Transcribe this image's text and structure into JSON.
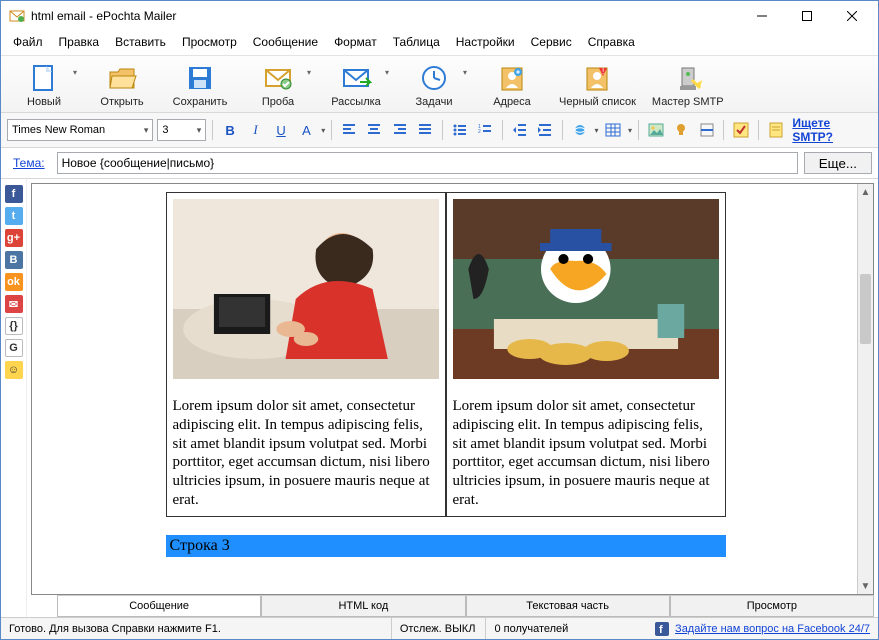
{
  "window": {
    "title": "html email - ePochta Mailer"
  },
  "menu": [
    "Файл",
    "Правка",
    "Вставить",
    "Просмотр",
    "Сообщение",
    "Формат",
    "Таблица",
    "Настройки",
    "Сервис",
    "Справка"
  ],
  "toolbar": [
    {
      "id": "new",
      "label": "Новый",
      "drop": true,
      "color": "#2e7bd6"
    },
    {
      "id": "open",
      "label": "Открыть",
      "color": "#e3a32b"
    },
    {
      "id": "save",
      "label": "Сохранить",
      "color": "#2e7bd6"
    },
    {
      "id": "probe",
      "label": "Проба",
      "drop": true,
      "color": "#d6a12e"
    },
    {
      "id": "send",
      "label": "Рассылка",
      "drop": true,
      "color": "#2e7bd6"
    },
    {
      "id": "tasks",
      "label": "Задачи",
      "drop": true,
      "color": "#2e7bd6"
    },
    {
      "id": "addresses",
      "label": "Адреса",
      "color": "#d6a12e"
    },
    {
      "id": "blacklist",
      "label": "Черный список",
      "color": "#d6a12e"
    },
    {
      "id": "smtp",
      "label": "Мастер SMTP",
      "color": "#7a7a7a"
    }
  ],
  "format": {
    "font": "Times New Roman",
    "size": "3",
    "smtp_link": "Ищете SMTP?"
  },
  "subject": {
    "label": "Тема:",
    "value": "Новое {сообщение|письмо}",
    "more": "Еще..."
  },
  "side_icons": [
    {
      "id": "fb",
      "bg": "#3b5998",
      "txt": "f"
    },
    {
      "id": "tw",
      "bg": "#55acee",
      "txt": "t"
    },
    {
      "id": "gp",
      "bg": "#db4437",
      "txt": "g+"
    },
    {
      "id": "vk",
      "bg": "#4c75a3",
      "txt": "B"
    },
    {
      "id": "ok",
      "bg": "#f7931e",
      "txt": "ok"
    },
    {
      "id": "ml",
      "bg": "#d44",
      "txt": "✉"
    },
    {
      "id": "code",
      "bg": "#fff",
      "txt": "{}",
      "fg": "#333"
    },
    {
      "id": "gg",
      "bg": "#fff",
      "txt": "G",
      "fg": "#333"
    },
    {
      "id": "smile",
      "bg": "#ffd54f",
      "txt": "☺",
      "fg": "#333"
    }
  ],
  "content": {
    "lorem": "Lorem ipsum dolor sit amet, consectetur adipiscing elit. In tempus adipiscing felis, sit amet blandit ipsum volutpat sed. Morbi porttitor, eget accumsan dictum, nisi libero ultricies ipsum, in posuere mauris neque at erat.",
    "row3": "Строка 3"
  },
  "bottom_tabs": [
    "Сообщение",
    "HTML код",
    "Текстовая часть",
    "Просмотр"
  ],
  "status": {
    "ready": "Готово. Для вызова Справки нажмите F1.",
    "track": "Отслеж. ВЫКЛ",
    "recip": "0 получателей",
    "fb": "Задайте нам вопрос на Facebook 24/7"
  }
}
